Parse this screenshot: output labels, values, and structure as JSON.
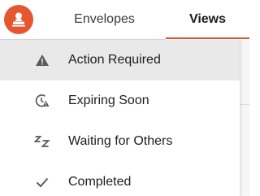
{
  "header": {
    "tabs": [
      {
        "label": "Envelopes",
        "selected": false
      },
      {
        "label": "Views",
        "selected": true
      }
    ],
    "avatar_icon": "user-stamp-icon",
    "accent_color": "#e5572f"
  },
  "menu": {
    "items": [
      {
        "label": "Action Required",
        "icon": "warning-triangle-icon",
        "active": true
      },
      {
        "label": "Expiring Soon",
        "icon": "clock-alert-icon",
        "active": false
      },
      {
        "label": "Waiting for Others",
        "icon": "sleep-zz-icon",
        "active": false
      },
      {
        "label": "Completed",
        "icon": "checkmark-icon",
        "active": false
      }
    ]
  }
}
